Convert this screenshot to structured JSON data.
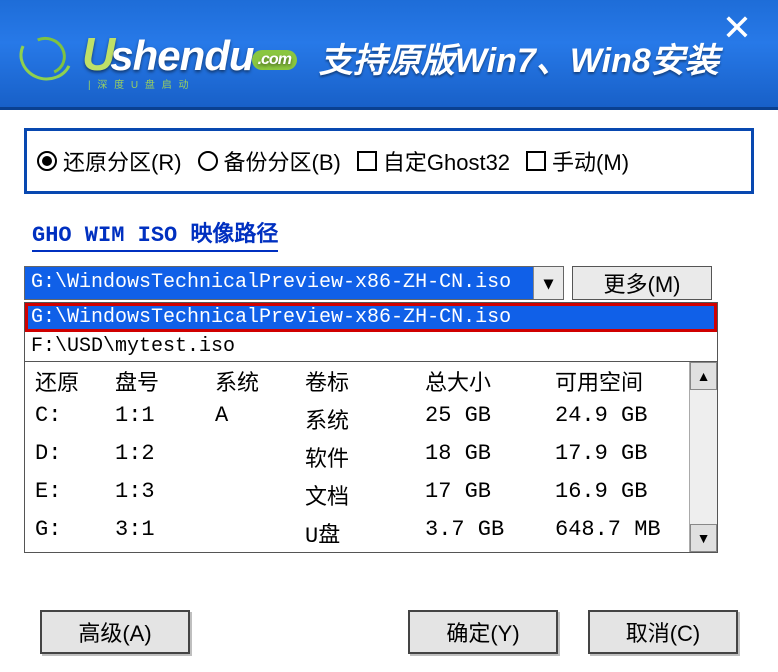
{
  "titlebar": {
    "logo_name": "shendu",
    "logo_tld": ".com",
    "logo_sub": "| 深 度 U 盘 启 动",
    "message": "支持原版Win7、Win8安装"
  },
  "options": {
    "restore": "还原分区(R)",
    "backup": "备份分区(B)",
    "custom_ghost": "自定Ghost32",
    "manual": "手动(M)",
    "selected": "restore"
  },
  "section_label": "GHO WIM ISO 映像路径",
  "combo": {
    "value": "G:\\WindowsTechnicalPreview-x86-ZH-CN.iso",
    "more_btn": "更多(M)"
  },
  "dropdown": {
    "items": [
      {
        "text": "G:\\WindowsTechnicalPreview-x86-ZH-CN.iso",
        "highlighted": true
      },
      {
        "text": "F:\\USD\\mytest.iso",
        "highlighted": false
      }
    ]
  },
  "table": {
    "headers": [
      "还原",
      "盘号",
      "系统",
      "卷标",
      "总大小",
      "可用空间"
    ],
    "rows": [
      {
        "drive": "C:",
        "disk": "1:1",
        "fs": "A",
        "label": "系统",
        "total": "25 GB",
        "free": "24.9 GB"
      },
      {
        "drive": "D:",
        "disk": "1:2",
        "fs": "",
        "label": "软件",
        "total": "18 GB",
        "free": "17.9 GB"
      },
      {
        "drive": "E:",
        "disk": "1:3",
        "fs": "",
        "label": "文档",
        "total": "17 GB",
        "free": "16.9 GB"
      },
      {
        "drive": "G:",
        "disk": "3:1",
        "fs": "",
        "label": "U盘",
        "total": "3.7 GB",
        "free": "648.7 MB"
      }
    ]
  },
  "buttons": {
    "advanced": "高级(A)",
    "ok": "确定(Y)",
    "cancel": "取消(C)"
  }
}
